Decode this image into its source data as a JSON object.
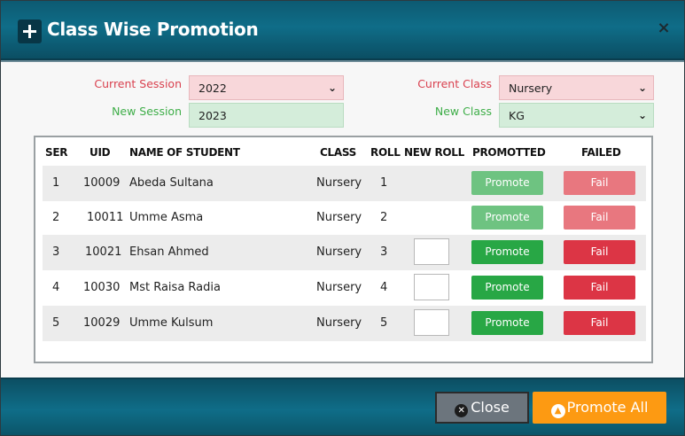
{
  "modal": {
    "title": "Class Wise Promotion",
    "close_glyph": "×"
  },
  "form": {
    "current_session_label": "Current Session",
    "current_session_value": "2022",
    "new_session_label": "New Session",
    "new_session_value": "2023",
    "current_class_label": "Current Class",
    "current_class_value": "Nursery",
    "new_class_label": "New Class",
    "new_class_value": "KG"
  },
  "table": {
    "headers": {
      "ser": "SER",
      "uid": "UID",
      "name": "NAME OF STUDENT",
      "class": "CLASS",
      "roll": "ROLL",
      "new_roll": "NEW ROLL",
      "promoted": "PROMOTTED",
      "failed": "FAILED"
    },
    "rows": [
      {
        "ser": "1",
        "uid": "10009",
        "name": "Abeda Sultana",
        "class": "Nursery",
        "roll": "1",
        "new_roll": "",
        "promote": "Promote",
        "fail": "Fail"
      },
      {
        "ser": "2",
        "uid": "10011",
        "name": "Umme Asma",
        "class": "Nursery",
        "roll": "2",
        "new_roll": "",
        "promote": "Promote",
        "fail": "Fail"
      },
      {
        "ser": "3",
        "uid": "10021",
        "name": "Ehsan Ahmed",
        "class": "Nursery",
        "roll": "3",
        "new_roll": "",
        "promote": "Promote",
        "fail": "Fail"
      },
      {
        "ser": "4",
        "uid": "10030",
        "name": "Mst Raisa Radia",
        "class": "Nursery",
        "roll": "4",
        "new_roll": "",
        "promote": "Promote",
        "fail": "Fail"
      },
      {
        "ser": "5",
        "uid": "10029",
        "name": "Umme Kulsum",
        "class": "Nursery",
        "roll": "5",
        "new_roll": "",
        "promote": "Promote",
        "fail": "Fail"
      }
    ]
  },
  "footer": {
    "close_label": "Close",
    "promote_all_label": "Promote All"
  },
  "colors": {
    "header_teal": "#0f6d88",
    "promote_green": "#28a745",
    "fail_red": "#dc3545",
    "promote_all_orange": "#fd9a12",
    "close_gray": "#6c757d"
  }
}
